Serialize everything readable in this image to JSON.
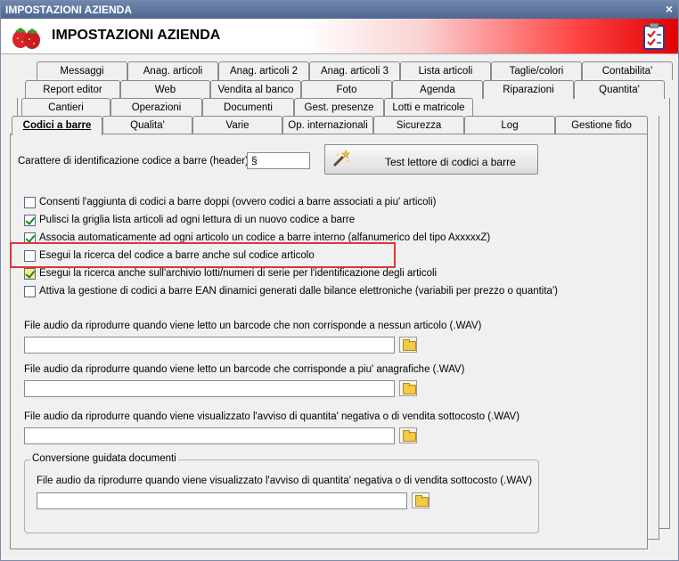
{
  "window": {
    "title": "IMPOSTAZIONI AZIENDA",
    "close_glyph": "×"
  },
  "header": {
    "title": "IMPOSTAZIONI AZIENDA",
    "logo_icon": "strawberry-icon",
    "right_icon": "checklist-icon"
  },
  "tabs_row1": [
    "Messaggi",
    "Anag. articoli",
    "Anag. articoli 2",
    "Anag. articoli 3",
    "Lista articoli",
    "Taglie/colori",
    "Contabilita'"
  ],
  "tabs_row2": [
    "Report editor",
    "Web",
    "Vendita al banco",
    "Foto",
    "Agenda",
    "Riparazioni",
    "Quantita'"
  ],
  "tabs_row3": [
    "Cantieri",
    "Operazioni",
    "Documenti",
    "Gest. presenze",
    "Lotti e matricole"
  ],
  "tabs_row4": [
    "Codici a barre",
    "Qualita'",
    "Varie",
    "Op. internazionali",
    "Sicurezza",
    "Log",
    "Gestione fido"
  ],
  "active_tab": "Codici a barre",
  "header_char": {
    "label": "Carattere di identificazione codice a barre (header) :",
    "value": "§"
  },
  "test_button": {
    "label": "Test lettore di codici a barre",
    "icon": "magic-wand-icon"
  },
  "checkboxes": [
    {
      "label": "Consenti l'aggiunta di codici a barre doppi (ovvero codici a barre associati a piu' articoli)",
      "checked": false
    },
    {
      "label": "Pulisci la griglia lista articoli ad ogni lettura di un nuovo codice a barre",
      "checked": true
    },
    {
      "label": "Associa automaticamente ad ogni articolo un codice a barre interno (alfanumerico del tipo AxxxxxZ)",
      "checked": true
    },
    {
      "label": "Esegui la ricerca del codice a barre anche sul codice articolo",
      "checked": false
    },
    {
      "label": "Esegui la ricerca anche sull'archivio lotti/numeri di serie per l'identificazione degli articoli",
      "checked": true
    },
    {
      "label": "Attiva la gestione di codici a barre EAN dinamici generati dalle bilance elettroniche (variabili per prezzo o quantita')",
      "checked": false
    }
  ],
  "audio_files": [
    {
      "label": "File audio da riprodurre quando viene letto un barcode che non corrisponde a nessun articolo (.WAV)",
      "value": ""
    },
    {
      "label": "File audio da riprodurre quando viene letto un barcode che corrisponde a piu' anagrafiche (.WAV)",
      "value": ""
    },
    {
      "label": "File audio da riprodurre quando viene visualizzato l'avviso di quantita' negativa o di vendita sottocosto (.WAV)",
      "value": ""
    }
  ],
  "group": {
    "title": "Conversione guidata documenti",
    "label": "File audio da riprodurre quando viene visualizzato l'avviso di quantita' negativa o di vendita sottocosto (.WAV)",
    "value": ""
  },
  "highlight_color": "#e0343a"
}
